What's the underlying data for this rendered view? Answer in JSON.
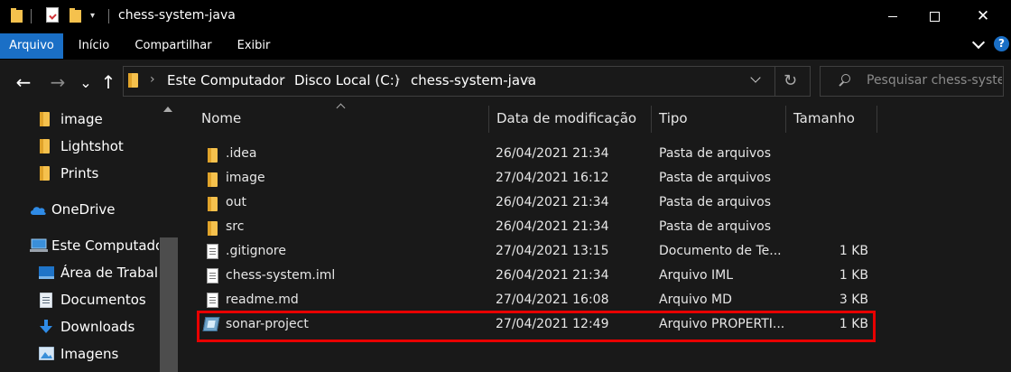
{
  "window": {
    "title": "chess-system-java",
    "quick_access_dropdown": "▾",
    "minimize_label": "—",
    "maximize_label": "☐",
    "close_label": "✕"
  },
  "ribbon": {
    "tabs": [
      {
        "label": "Arquivo",
        "active": true
      },
      {
        "label": "Início",
        "active": false
      },
      {
        "label": "Compartilhar",
        "active": false
      },
      {
        "label": "Exibir",
        "active": false
      }
    ],
    "help_label": "?"
  },
  "nav": {
    "back_icon": "←",
    "forward_icon": "→",
    "recent_icon": "⌄",
    "up_icon": "↑"
  },
  "address": {
    "breadcrumbs": [
      "Este Computador",
      "Disco Local (C:)",
      "chess-system-java"
    ],
    "separator": "›",
    "refresh_icon": "↻"
  },
  "search": {
    "placeholder": "Pesquisar chess-syste..."
  },
  "navpane": {
    "items": [
      {
        "label": "image",
        "icon": "folder-icon"
      },
      {
        "label": "Lightshot",
        "icon": "folder-icon"
      },
      {
        "label": "Prints",
        "icon": "folder-icon"
      },
      {
        "label": "OneDrive",
        "icon": "cloud-icon"
      },
      {
        "label": "Este Computador",
        "icon": "computer-icon"
      },
      {
        "label": "Área de Trabalho",
        "icon": "desktop-icon"
      },
      {
        "label": "Documentos",
        "icon": "documents-icon"
      },
      {
        "label": "Downloads",
        "icon": "download-icon"
      },
      {
        "label": "Imagens",
        "icon": "pictures-icon"
      }
    ]
  },
  "columns": {
    "name": "Nome",
    "date": "Data de modificação",
    "type": "Tipo",
    "size": "Tamanho"
  },
  "files": [
    {
      "name": ".idea",
      "date": "26/04/2021 21:34",
      "type": "Pasta de arquivos",
      "size": "",
      "icon": "folder-icon"
    },
    {
      "name": "image",
      "date": "27/04/2021 16:12",
      "type": "Pasta de arquivos",
      "size": "",
      "icon": "folder-icon"
    },
    {
      "name": "out",
      "date": "26/04/2021 21:34",
      "type": "Pasta de arquivos",
      "size": "",
      "icon": "folder-icon"
    },
    {
      "name": "src",
      "date": "26/04/2021 21:34",
      "type": "Pasta de arquivos",
      "size": "",
      "icon": "folder-icon"
    },
    {
      "name": ".gitignore",
      "date": "27/04/2021 13:15",
      "type": "Documento de Te...",
      "size": "1 KB",
      "icon": "text-file-icon"
    },
    {
      "name": "chess-system.iml",
      "date": "26/04/2021 21:34",
      "type": "Arquivo IML",
      "size": "1 KB",
      "icon": "file-icon"
    },
    {
      "name": "readme.md",
      "date": "27/04/2021 16:08",
      "type": "Arquivo MD",
      "size": "3 KB",
      "icon": "file-icon"
    },
    {
      "name": "sonar-project",
      "date": "27/04/2021 12:49",
      "type": "Arquivo PROPERTI...",
      "size": "1 KB",
      "icon": "properties-file-icon",
      "highlighted": true
    }
  ],
  "colors": {
    "highlight": "#e80000",
    "ribbon_active": "#1a6fc6",
    "folder": "#f5c14d"
  }
}
